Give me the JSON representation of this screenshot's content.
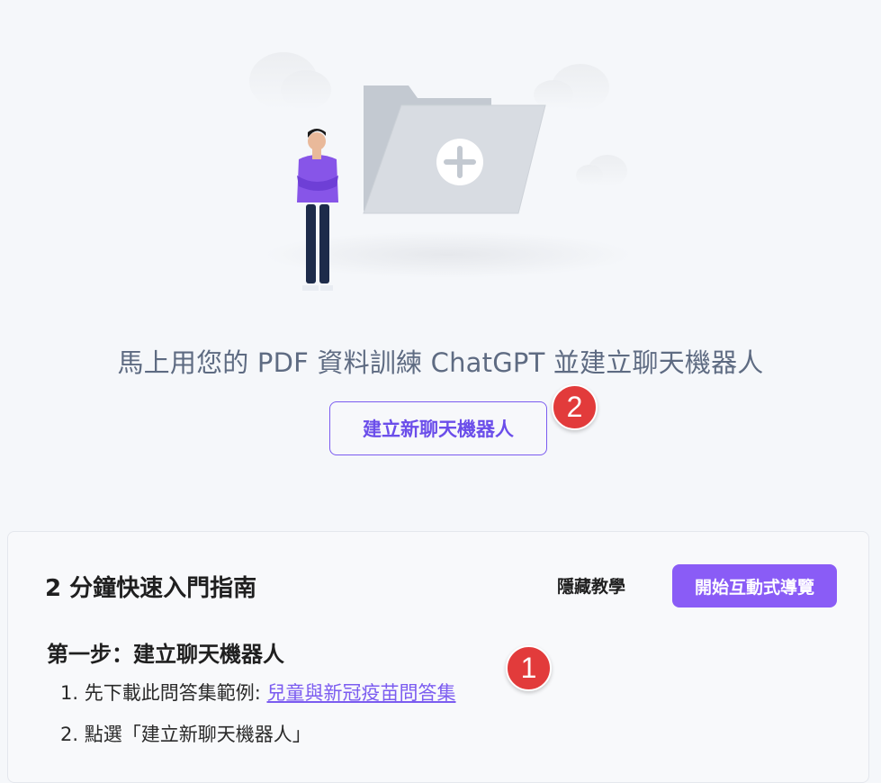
{
  "hero": {
    "tagline": "馬上用您的 PDF 資料訓練 ChatGPT 並建立聊天機器人",
    "create_button": "建立新聊天機器人"
  },
  "badges": {
    "first": "1",
    "second": "2"
  },
  "guide": {
    "title": "2 分鐘快速入門指南",
    "hide_label": "隱藏教學",
    "tour_label": "開始互動式導覽",
    "step1": {
      "heading": "第一步：建立聊天機器人",
      "items": [
        {
          "num": "1.",
          "text": "先下載此問答集範例: ",
          "link": "兒童與新冠疫苗問答集"
        },
        {
          "num": "2.",
          "text": "點選「建立新聊天機器人」"
        }
      ]
    }
  },
  "colors": {
    "accent": "#8a5cf6",
    "badge": "#e23b3b",
    "tagline": "#5e6b82"
  },
  "illustration": {
    "icons": [
      "folder-icon",
      "plus-icon",
      "person-illustration",
      "cloud-icon"
    ]
  }
}
